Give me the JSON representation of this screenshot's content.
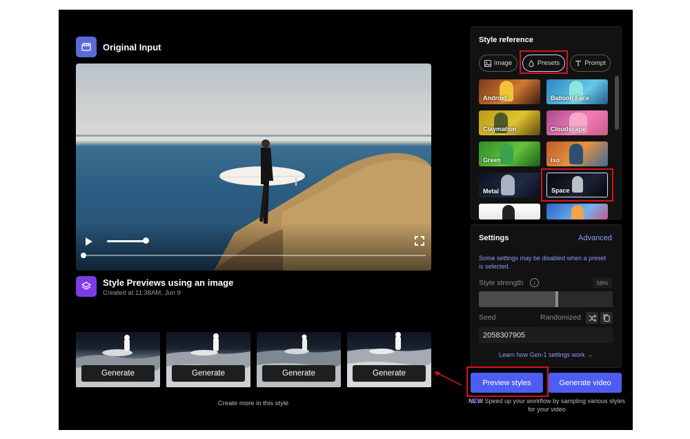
{
  "original_input": {
    "title": "Original Input"
  },
  "style_previews": {
    "title": "Style Previews using an image",
    "created": "Created at 11:38AM, Jun 9",
    "generate_labels": [
      "Generate",
      "Generate",
      "Generate",
      "Generate"
    ],
    "create_more": "Create more in this style"
  },
  "style_reference": {
    "title": "Style reference",
    "tabs": [
      {
        "label": "Image",
        "icon": "image-icon"
      },
      {
        "label": "Presets",
        "icon": "drop-icon",
        "active": true
      },
      {
        "label": "Prompt",
        "icon": "text-icon"
      }
    ],
    "presets": [
      "Android",
      "Balloon Face",
      "Claymation",
      "Cloudscape",
      "Green",
      "Iso",
      "Metal",
      "Space",
      "",
      ""
    ],
    "selected_preset": "Space"
  },
  "settings": {
    "title": "Settings",
    "advanced": "Advanced",
    "note": "Some settings may be disabled when a preset is selected.",
    "style_strength_label": "Style strength",
    "style_strength_value": "58%",
    "style_strength_fraction": 0.58,
    "seed_label": "Seed",
    "randomized_label": "Randomized",
    "seed_value": "2058307905",
    "learn_link": "Learn how Gen-1 settings work →"
  },
  "actions": {
    "preview": "Preview styles",
    "generate_video": "Generate video",
    "new_badge": "NEW",
    "new_text": " Speed up your workflow by sampling various styles for your video"
  },
  "colors": {
    "accent": "#4d5df1",
    "link": "#8e9bff",
    "highlight": "#d8121b"
  }
}
